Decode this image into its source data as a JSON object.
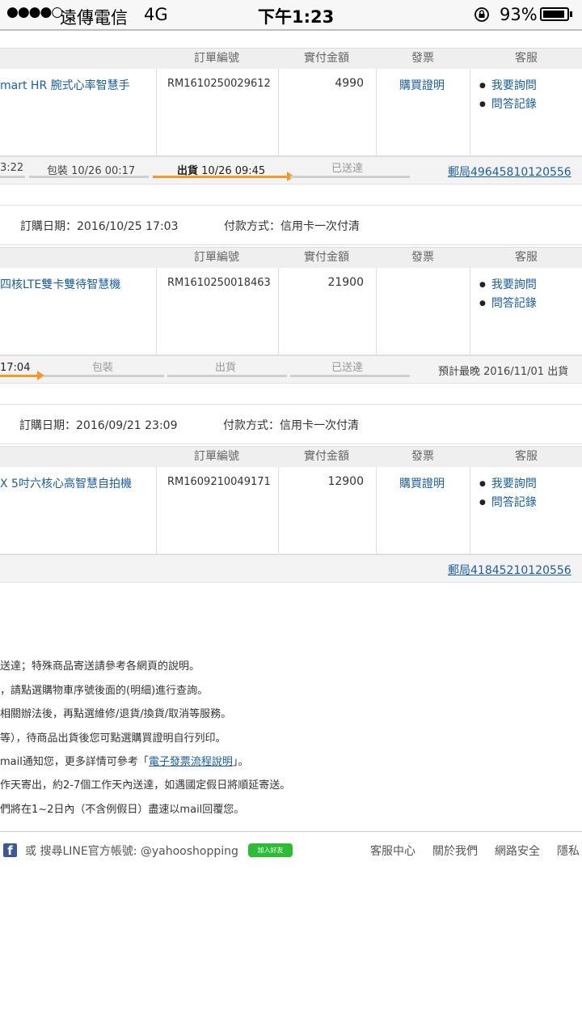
{
  "status_bar": {
    "signal": "●●●●○",
    "carrier": "遠傳電信",
    "network": "4G",
    "time": "下午1:23",
    "battery_percent": "93%",
    "battery_level": 0.93
  },
  "columns": {
    "order_no": "訂單編號",
    "amount": "實付金額",
    "invoice": "發票",
    "service": "客服"
  },
  "orders": [
    {
      "product": "mart HR 腕式心率智慧手",
      "order_no": "RM1610250029612",
      "amount": "4990",
      "invoice_link": "購買證明",
      "service_ask": "我要詢問",
      "service_history": "問答記錄",
      "tracking": {
        "step1": "3:22",
        "step2": "包裝 10/26 00:17",
        "step3_bold": "出貨",
        "step3_time": " 10/26 09:45",
        "step4": "已送達",
        "progress": 0.75,
        "right_link": "郵局49645810120556"
      }
    },
    {
      "order_date_label": "訂購日期：2016/10/25 17:03",
      "payment_label": "付款方式：信用卡一次付清",
      "product": "四核LTE雙卡雙待智慧機",
      "order_no": "RM1610250018463",
      "amount": "21900",
      "invoice_link": "",
      "service_ask": "我要詢問",
      "service_history": "問答記錄",
      "tracking": {
        "step1": "17:04",
        "step2": "包裝",
        "step3": "出貨",
        "step4": "已送達",
        "progress": 0.25,
        "right_text": "預計最晚 2016/11/01 出貨"
      }
    },
    {
      "order_date_label": "訂購日期：2016/09/21 23:09",
      "payment_label": "付款方式：信用卡一次付清",
      "product": "X 5吋六核心高智慧自拍機",
      "order_no": "RM1609210049171",
      "amount": "12900",
      "invoice_link": "購買證明",
      "service_ask": "我要詢問",
      "service_history": "問答記錄",
      "tracking": {
        "right_link": "郵局41845210120556"
      }
    }
  ],
  "notes": [
    "送達；特殊商品寄送請參考各網頁的說明。",
    "，請點選購物車序號後面的(明細)進行查詢。",
    "相關辦法後，再點選維修/退貨/換貨/取消等服務。",
    "等），待商品出貨後您可點選購買證明自行列印。",
    "作天寄出，約2-7個工作天內送達，如遇國定假日將順延寄送。",
    "們將在1~2日內（不含例假日）盡速以mail回覆您。"
  ],
  "note_einvoice": {
    "prefix": "mail通知您，更多詳情可參考「",
    "link": "電子發票流程說明",
    "suffix": "」。"
  },
  "footer": {
    "facebook_glyph": "f",
    "line_text": "或 搜尋LINE官方帳號: @yahooshopping",
    "line_badge": "加入好友",
    "links": [
      "客服中心",
      "關於我們",
      "網路安全",
      "隱私"
    ]
  }
}
